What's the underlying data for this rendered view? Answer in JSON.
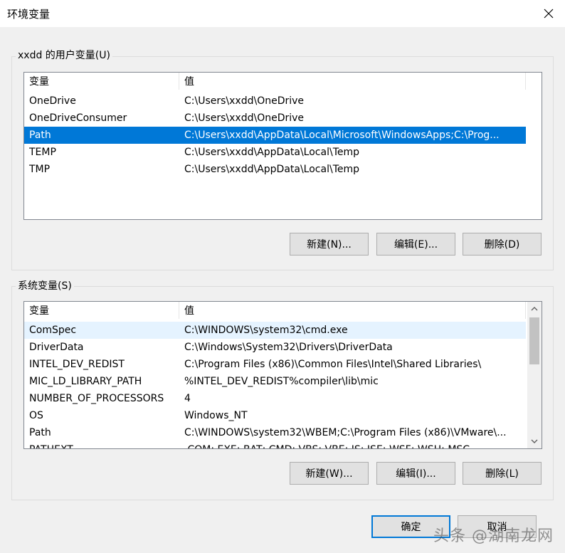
{
  "window": {
    "title": "环境变量"
  },
  "user_vars": {
    "group_label": "xxdd 的用户变量(U)",
    "columns": [
      "变量",
      "值"
    ],
    "rows": [
      {
        "name": "OneDrive",
        "value": "C:\\Users\\xxdd\\OneDrive"
      },
      {
        "name": "OneDriveConsumer",
        "value": "C:\\Users\\xxdd\\OneDrive"
      },
      {
        "name": "Path",
        "value": "C:\\Users\\xxdd\\AppData\\Local\\Microsoft\\WindowsApps;C:\\Prog..."
      },
      {
        "name": "TEMP",
        "value": "C:\\Users\\xxdd\\AppData\\Local\\Temp"
      },
      {
        "name": "TMP",
        "value": "C:\\Users\\xxdd\\AppData\\Local\\Temp"
      }
    ],
    "buttons": {
      "new": "新建(N)...",
      "edit": "编辑(E)...",
      "delete": "删除(D)"
    }
  },
  "system_vars": {
    "group_label": "系统变量(S)",
    "columns": [
      "变量",
      "值"
    ],
    "rows": [
      {
        "name": "ComSpec",
        "value": "C:\\WINDOWS\\system32\\cmd.exe"
      },
      {
        "name": "DriverData",
        "value": "C:\\Windows\\System32\\Drivers\\DriverData"
      },
      {
        "name": "INTEL_DEV_REDIST",
        "value": "C:\\Program Files (x86)\\Common Files\\Intel\\Shared Libraries\\"
      },
      {
        "name": "MIC_LD_LIBRARY_PATH",
        "value": "%INTEL_DEV_REDIST%compiler\\lib\\mic"
      },
      {
        "name": "NUMBER_OF_PROCESSORS",
        "value": "4"
      },
      {
        "name": "OS",
        "value": "Windows_NT"
      },
      {
        "name": "Path",
        "value": "C:\\WINDOWS\\system32\\WBEM;C:\\Program Files (x86)\\VMware\\..."
      },
      {
        "name": "PATHEXT",
        "value": ".COM;.EXE;.BAT;.CMD;.VBS;.VBE;.JS;.JSE;.WSF;.WSH;.MSC"
      }
    ],
    "buttons": {
      "new": "新建(W)...",
      "edit": "编辑(I)...",
      "delete": "删除(L)"
    }
  },
  "footer": {
    "ok": "确定",
    "cancel": "取消"
  },
  "watermark": "头条 @湖南龙网",
  "colors": {
    "selection": "#0078d7",
    "hover": "#e5f3ff",
    "primary_border": "#0078d7"
  }
}
